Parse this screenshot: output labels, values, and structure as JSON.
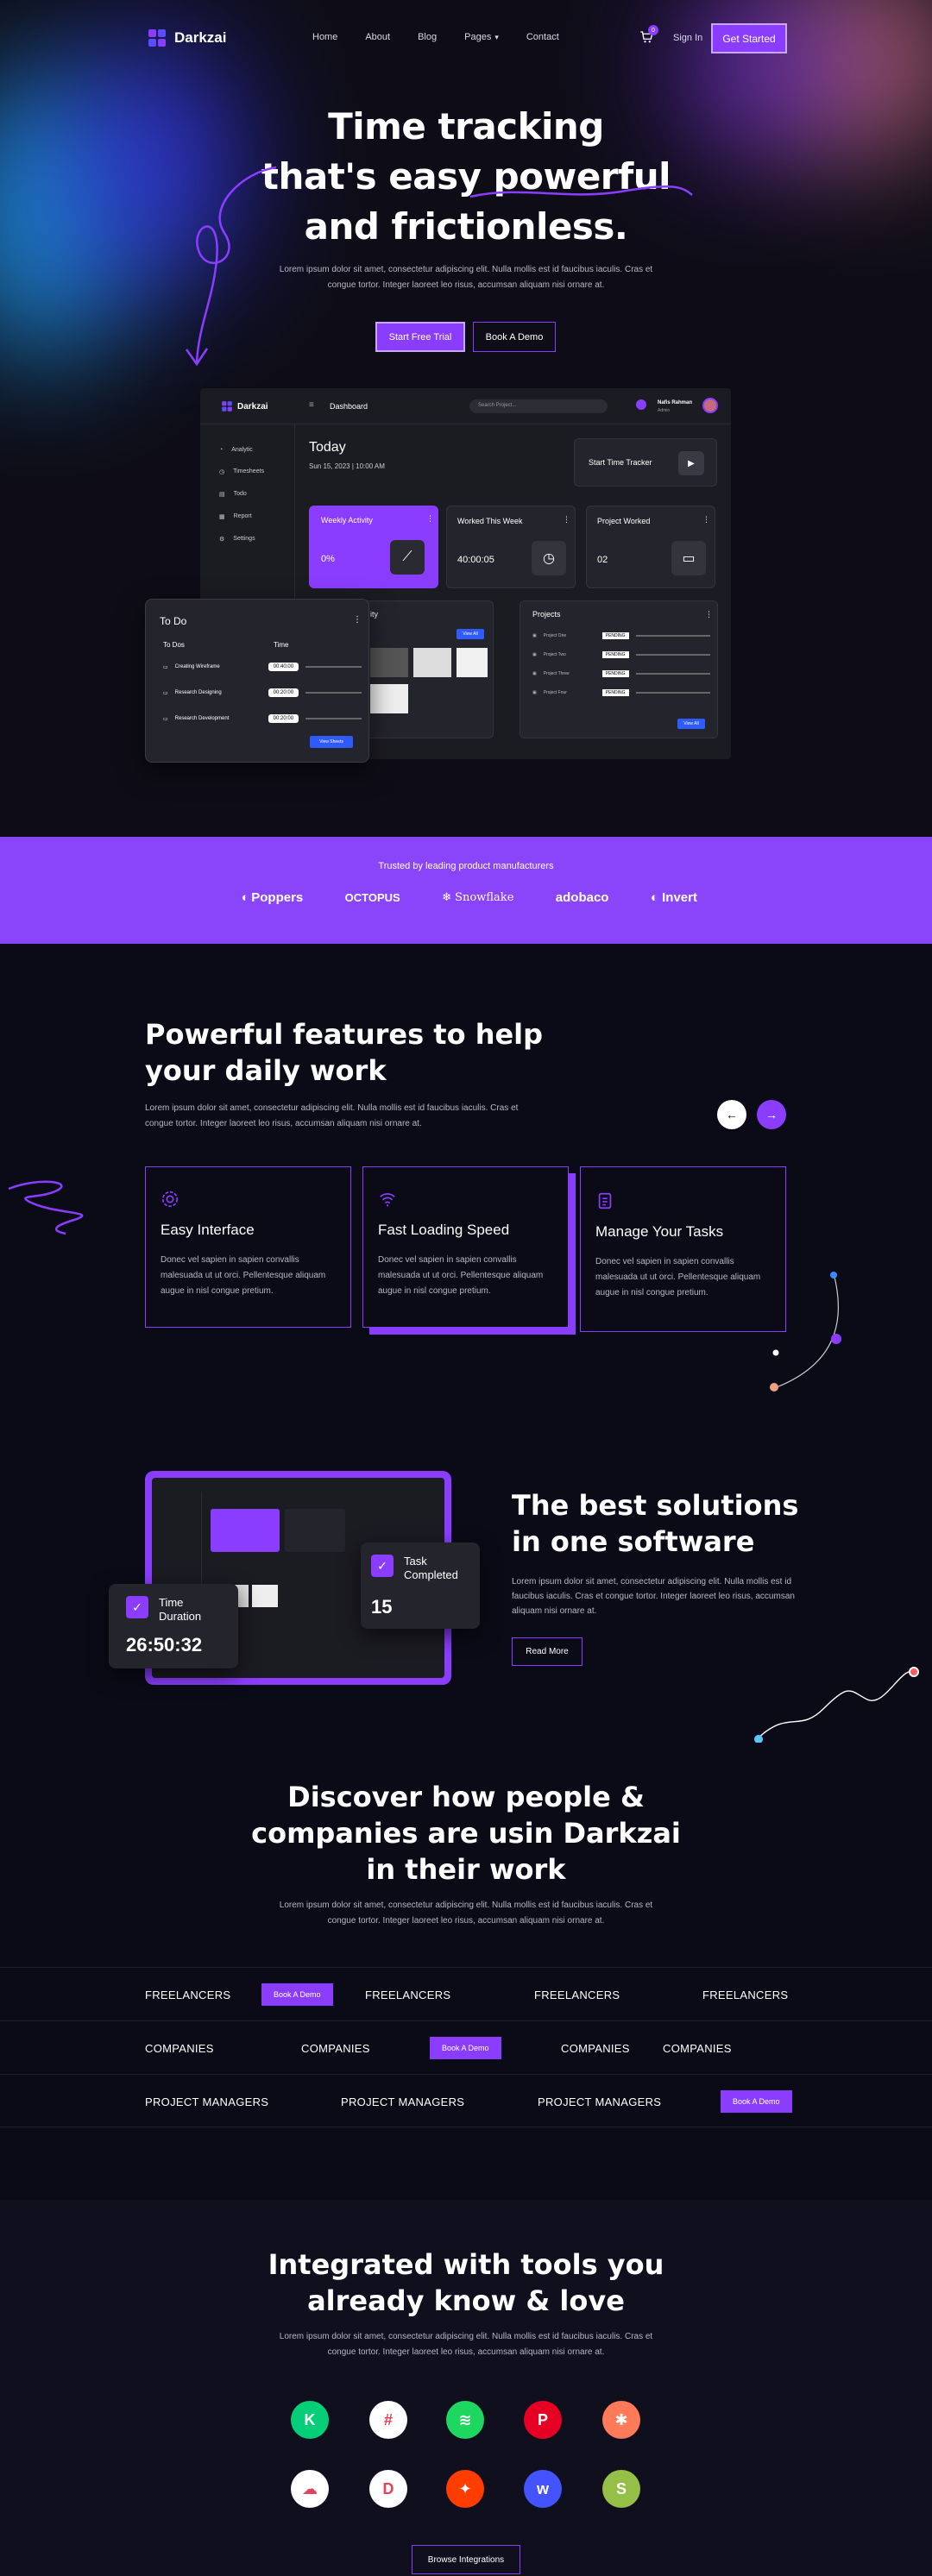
{
  "nav": {
    "brand": "Darkzai",
    "links": [
      "Home",
      "About",
      "Blog",
      "Pages",
      "Contact"
    ],
    "cart_count": "0",
    "sign_in": "Sign In",
    "cta": "Get Started"
  },
  "hero": {
    "title_line1": "Time tracking",
    "title_line2": "that's easy powerful",
    "title_line3": "and frictionless.",
    "subtitle_line1": "Lorem ipsum dolor sit amet, consectetur adipiscing elit. Nulla mollis est id faucibus iaculis. Cras et",
    "subtitle_line2": "congue tortor. Integer laoreet leo risus, accumsan aliquam nisi ornare at.",
    "primary_btn": "Start Free Trial",
    "secondary_btn": "Book A Demo"
  },
  "dashboard": {
    "brand": "Darkzai",
    "header": "Dashboard",
    "search_placeholder": "Search Project...",
    "user_name": "Nafis Rahman",
    "user_role": "Admin",
    "sidebar": [
      "Analytic",
      "Timesheets",
      "Todo",
      "Report",
      "Settings"
    ],
    "today": "Today",
    "date": "Sun 15, 2023 | 10:00 AM",
    "tracker_label": "Start Time Tracker",
    "weekly_title": "Weekly Activity",
    "weekly_value": "0%",
    "worked_title": "Worked This Week",
    "worked_value": "40:00:05",
    "project_title": "Project Worked",
    "project_value": "02",
    "activity_title": "ity",
    "view_all": "View All",
    "projects_title": "Projects",
    "projects": [
      "Project One",
      "Project Two",
      "Project Three",
      "Project Four"
    ],
    "project_badge": "PENDING",
    "todo": {
      "title": "To Do",
      "col1": "To Dos",
      "col2": "Time",
      "items": [
        {
          "name": "Creating Wireframe",
          "time": "00:40:00"
        },
        {
          "name": "Research Designing",
          "time": "00:20:00"
        },
        {
          "name": "Research Development",
          "time": "00:20:00"
        }
      ],
      "btn": "View Sheets"
    }
  },
  "trusted": {
    "title": "Trusted by leading product manufacturers",
    "logos": [
      "Poppers",
      "OCTOPUS",
      "Snowflake",
      "adobaco",
      "Invert"
    ]
  },
  "features": {
    "title_line1": "Powerful features to help",
    "title_line2": "your daily work",
    "subtitle_line1": "Lorem ipsum dolor sit amet, consectetur adipiscing elit. Nulla mollis est id faucibus iaculis. Cras et",
    "subtitle_line2": "congue tortor. Integer laoreet leo risus, accumsan aliquam nisi ornare at.",
    "cards": [
      {
        "title": "Easy Interface",
        "text": "Donec vel sapien in sapien convallis malesuada ut ut orci. Pellentesque aliquam augue in nisl congue pretium."
      },
      {
        "title": "Fast Loading Speed",
        "text": "Donec vel sapien in sapien convallis malesuada ut ut orci. Pellentesque aliquam augue in nisl congue pretium."
      },
      {
        "title": "Manage Your Tasks",
        "text": "Donec vel sapien in sapien convallis malesuada ut ut orci. Pellentesque aliquam augue in nisl congue pretium."
      }
    ]
  },
  "solutions": {
    "title_line1": "The best solutions",
    "title_line2": "in one software",
    "text_line1": "Lorem ipsum dolor sit amet, consectetur adipiscing elit. Nulla mollis est id",
    "text_line2": "faucibus iaculis. Cras et congue tortor. Integer laoreet leo risus, accumsan",
    "text_line3": "aliquam nisi ornare at.",
    "btn": "Read More",
    "task_label": "Task Completed",
    "task_value": "15",
    "duration_label": "Time Duration",
    "duration_value": "26:50:32"
  },
  "discover": {
    "title_line1": "Discover how people &",
    "title_line2": "companies are usin Darkzai",
    "title_line3": "in their work",
    "subtitle_line1": "Lorem ipsum dolor sit amet, consectetur adipiscing elit. Nulla mollis est id faucibus iaculis. Cras et",
    "subtitle_line2": "congue tortor. Integer laoreet leo risus, accumsan aliquam nisi ornare at.",
    "row1": "FREELANCERS",
    "row2": "COMPANIES",
    "row3": "PROJECT MANAGERS",
    "pill": "Book A Demo"
  },
  "integrations": {
    "title_line1": "Integrated with tools you",
    "title_line2": "already know & love",
    "subtitle_line1": "Lorem ipsum dolor sit amet, consectetur adipiscing elit. Nulla mollis est id faucibus iaculis. Cras et",
    "subtitle_line2": "congue tortor. Integer laoreet leo risus, accumsan aliquam nisi ornare at.",
    "btn": "Browse Integrations",
    "tools": [
      {
        "icon": "kickstarter-icon",
        "color": "#05ce78",
        "glyph": "K"
      },
      {
        "icon": "slack-icon",
        "color": "#ffffff",
        "glyph": "#"
      },
      {
        "icon": "spotify-icon",
        "color": "#1ed760",
        "glyph": "≋"
      },
      {
        "icon": "pinterest-icon",
        "color": "#e60023",
        "glyph": "P"
      },
      {
        "icon": "hubspot-icon",
        "color": "#ff7a59",
        "glyph": "✱"
      },
      {
        "icon": "salesforce-icon",
        "color": "#ffffff",
        "glyph": "☁"
      },
      {
        "icon": "dropbox-icon",
        "color": "#ffffff",
        "glyph": "D"
      },
      {
        "icon": "craft-icon",
        "color": "#ff3d00",
        "glyph": "✦"
      },
      {
        "icon": "webflow-icon",
        "color": "#4353ff",
        "glyph": "w"
      },
      {
        "icon": "shopify-icon",
        "color": "#95bf47",
        "glyph": "S"
      }
    ]
  }
}
